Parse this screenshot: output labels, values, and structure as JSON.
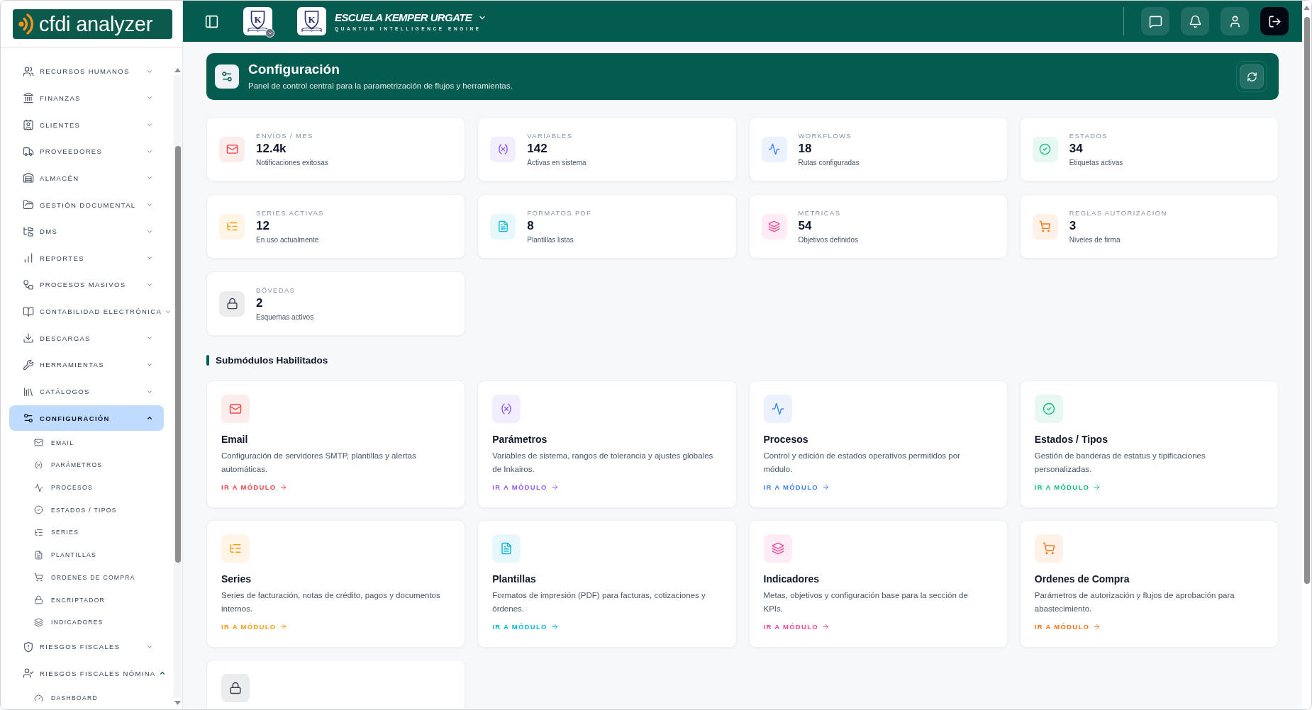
{
  "sidebar": {
    "brand": "cfdi analyzer",
    "items": [
      {
        "label": "RECURSOS HUMANOS",
        "selected": false,
        "expanded": false
      },
      {
        "label": "FINANZAS",
        "selected": false,
        "expanded": false
      },
      {
        "label": "CLIENTES",
        "selected": false,
        "expanded": false
      },
      {
        "label": "PROVEEDORES",
        "selected": false,
        "expanded": false
      },
      {
        "label": "ALMACÉN",
        "selected": false,
        "expanded": false
      },
      {
        "label": "GESTIÓN DOCUMENTAL",
        "selected": false,
        "expanded": false
      },
      {
        "label": "DMS",
        "selected": false,
        "expanded": false
      },
      {
        "label": "REPORTES",
        "selected": false,
        "expanded": false
      },
      {
        "label": "PROCESOS MASIVOS",
        "selected": false,
        "expanded": false
      },
      {
        "label": "CONTABILIDAD ELECTRÓNICA",
        "selected": false,
        "expanded": false
      },
      {
        "label": "DESCARGAS",
        "selected": false,
        "expanded": false
      },
      {
        "label": "HERRAMIENTAS",
        "selected": false,
        "expanded": false
      },
      {
        "label": "CATÁLOGOS",
        "selected": false,
        "expanded": false
      },
      {
        "label": "CONFIGURACIÓN",
        "selected": true,
        "expanded": true,
        "children": [
          {
            "label": "EMAIL",
            "selected": false
          },
          {
            "label": "PARÁMETROS",
            "selected": false
          },
          {
            "label": "PROCESOS",
            "selected": false
          },
          {
            "label": "ESTADOS / TIPOS",
            "selected": false
          },
          {
            "label": "SERIES",
            "selected": false
          },
          {
            "label": "PLANTILLAS",
            "selected": false
          },
          {
            "label": "ORDENES DE COMPRA",
            "selected": false
          },
          {
            "label": "ENCRIPTADOR",
            "selected": false
          },
          {
            "label": "INDICADORES",
            "selected": false
          }
        ]
      },
      {
        "label": "RIESGOS FISCALES",
        "selected": false,
        "expanded": false
      },
      {
        "label": "RIESGOS FISCALES NÓMINA",
        "selected": false,
        "expanded": true,
        "children": [
          {
            "label": "DASHBOARD",
            "selected": false
          }
        ]
      }
    ]
  },
  "topbar": {
    "switcher": {
      "crest_letter": "K"
    },
    "school": {
      "crest_letter": "K",
      "name": "ESCUELA KEMPER URGATE",
      "tagline": "QUANTUM INTELLIGENCE ENGINE"
    }
  },
  "banner": {
    "title": "Configuración",
    "subtitle": "Panel de control central para la parametrización de flujos y herramientas."
  },
  "stats": [
    {
      "label": "ENVÍOS / MES",
      "value": "12.4k",
      "note": "Notificaciones exitosas",
      "color": "#ef4444"
    },
    {
      "label": "VARIABLES",
      "value": "142",
      "note": "Activas en sistema",
      "color": "#8b5cf6"
    },
    {
      "label": "WORKFLOWS",
      "value": "18",
      "note": "Rutas configuradas",
      "color": "#3b82f6"
    },
    {
      "label": "ESTADOS",
      "value": "34",
      "note": "Etiquetas activas",
      "color": "#10b981"
    },
    {
      "label": "SERIES ACTIVAS",
      "value": "12",
      "note": "En uso actualmente",
      "color": "#f59e0b"
    },
    {
      "label": "FORMATOS PDF",
      "value": "8",
      "note": "Plantillas listas",
      "color": "#06b6d4"
    },
    {
      "label": "MÉTRICAS",
      "value": "54",
      "note": "Objetivos definidos",
      "color": "#ec4899"
    },
    {
      "label": "REGLAS AUTORIZACIÓN",
      "value": "3",
      "note": "Niveles de firma",
      "color": "#f97316"
    },
    {
      "label": "BÓVEDAS",
      "value": "2",
      "note": "Esquemas activos",
      "color": "#374151"
    }
  ],
  "section_title": "Submódulos Habilitados",
  "modules": [
    {
      "title": "Email",
      "description": "Configuración de servidores SMTP, plantillas y alertas automáticas.",
      "link": "IR A MÓDULO",
      "color": "#ef4444"
    },
    {
      "title": "Parámetros",
      "description": "Variables de sistema, rangos de tolerancia y ajustes globales de Inkairos.",
      "link": "IR A MÓDULO",
      "color": "#8b5cf6"
    },
    {
      "title": "Procesos",
      "description": "Control y edición de estados operativos permitidos por módulo.",
      "link": "IR A MÓDULO",
      "color": "#3b82f6"
    },
    {
      "title": "Estados / Tipos",
      "description": "Gestión de banderas de estatus y tipificaciones personalizadas.",
      "link": "IR A MÓDULO",
      "color": "#10b981"
    },
    {
      "title": "Series",
      "description": "Series de facturación, notas de crédito, pagos y documentos internos.",
      "link": "IR A MÓDULO",
      "color": "#f59e0b"
    },
    {
      "title": "Plantillas",
      "description": "Formatos de impresión (PDF) para facturas, cotizaciones y órdenes.",
      "link": "IR A MÓDULO",
      "color": "#06b6d4"
    },
    {
      "title": "Indicadores",
      "description": "Metas, objetivos y configuración base para la sección de KPIs.",
      "link": "IR A MÓDULO",
      "color": "#ec4899"
    },
    {
      "title": "Ordenes de Compra",
      "description": "Parámetros de autorización y flujos de aprobación para abastecimiento.",
      "link": "IR A MÓDULO",
      "color": "#f97316"
    },
    {
      "color": "#374151"
    }
  ]
}
